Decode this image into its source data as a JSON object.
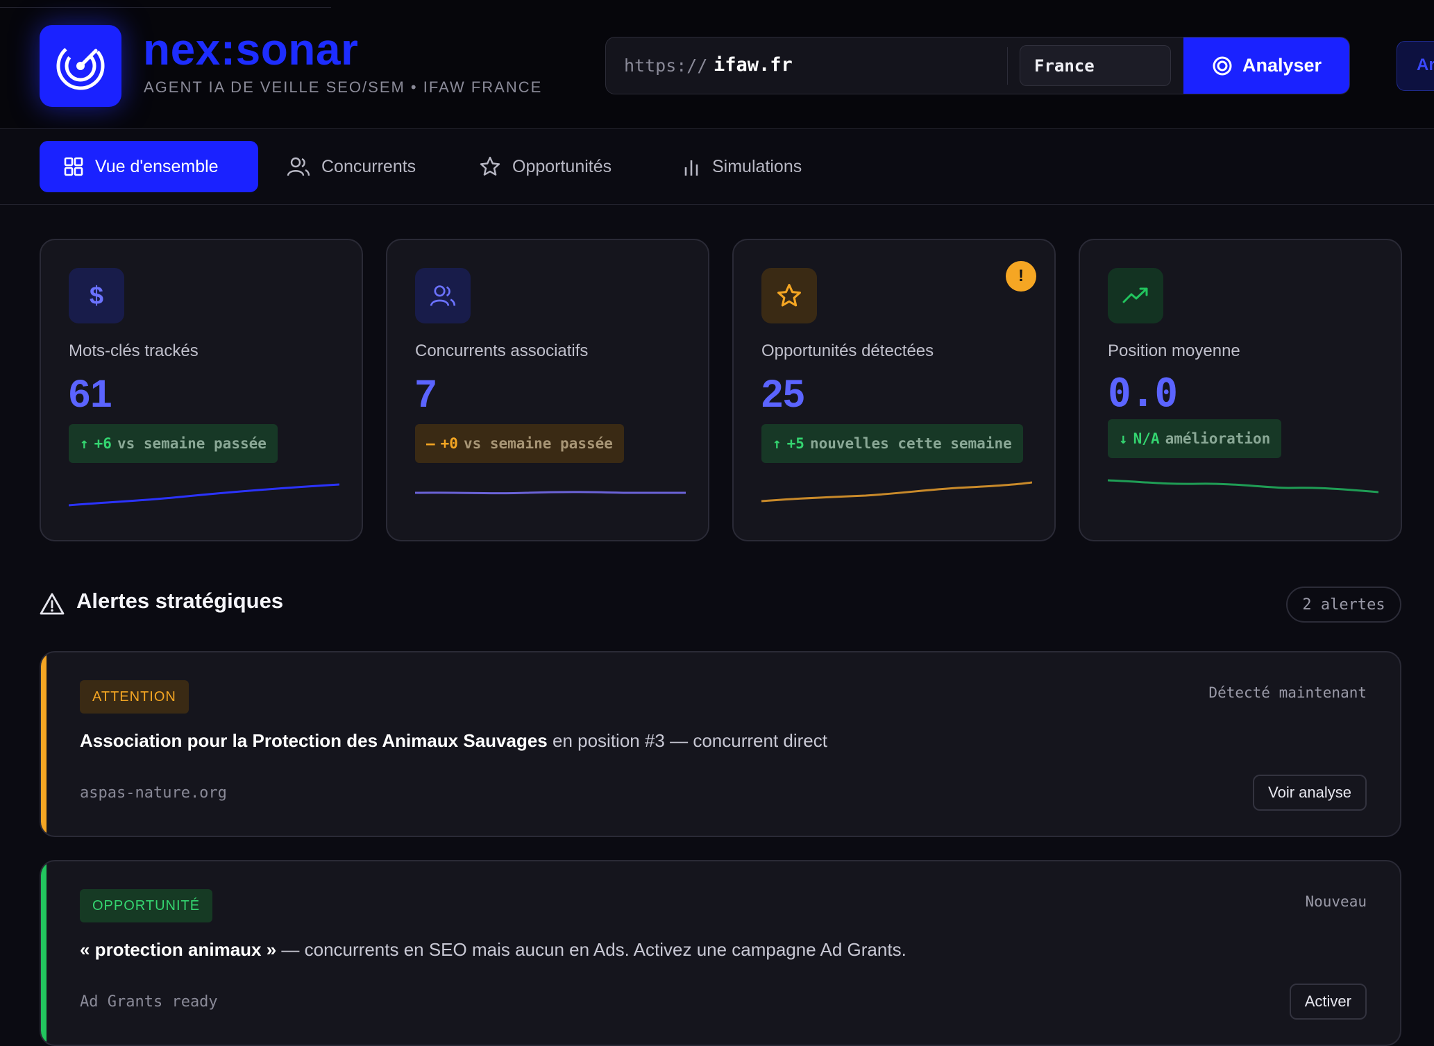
{
  "header": {
    "brand": "nex:sonar",
    "tagline": "AGENT IA DE VEILLE SEO/SEM • IFAW FRANCE",
    "url_prefix": "https://",
    "url_value": "ifaw.fr",
    "country": "France",
    "analyse_label": "Analyser",
    "extra_label": "Ar"
  },
  "tabs": [
    {
      "label": "Vue d'ensemble",
      "icon": "grid-icon",
      "active": true
    },
    {
      "label": "Concurrents",
      "icon": "users-icon",
      "active": false
    },
    {
      "label": "Opportunités",
      "icon": "star-icon",
      "active": false
    },
    {
      "label": "Simulations",
      "icon": "bar-chart-icon",
      "active": false
    }
  ],
  "stats": [
    {
      "icon": "dollar-icon",
      "label": "Mots-clés trackés",
      "value": "61",
      "delta": "+6",
      "delta_suffix": "vs semaine passée",
      "trend": "up",
      "color": "#2b33ff"
    },
    {
      "icon": "users-icon",
      "label": "Concurrents associatifs",
      "value": "7",
      "delta": "+0",
      "delta_suffix": "vs semaine passée",
      "trend": "flat",
      "color": "#6b63d8"
    },
    {
      "icon": "star-icon",
      "label": "Opportunités détectées",
      "value": "25",
      "delta": "+5",
      "delta_suffix": "nouvelles cette semaine",
      "trend": "up",
      "color": "#c98a2a",
      "warning": "!"
    },
    {
      "icon": "trending-up-icon",
      "label": "Position moyenne",
      "value": "0.0",
      "delta": "N/A",
      "delta_suffix": "amélioration",
      "trend": "down",
      "color": "#1f9d55"
    }
  ],
  "alerts_section": {
    "title": "Alertes stratégiques",
    "count": "2 alertes"
  },
  "alerts": [
    {
      "tag": "ATTENTION",
      "stamp": "Détecté maintenant",
      "bold": "Association pour la Protection des Animaux Sauvages",
      "text": " en position #3 — concurrent direct",
      "domain": "aspas-nature.org",
      "action": "Voir analyse",
      "color": "#f5a623"
    },
    {
      "tag": "OPPORTUNITÉ",
      "stamp": "Nouveau",
      "bold": "« protection animaux »",
      "text": " — concurrents en SEO mais aucun en Ads. Activez une campagne Ad Grants.",
      "domain": "Ad Grants ready",
      "action": "Activer",
      "color": "#22c55e"
    }
  ]
}
